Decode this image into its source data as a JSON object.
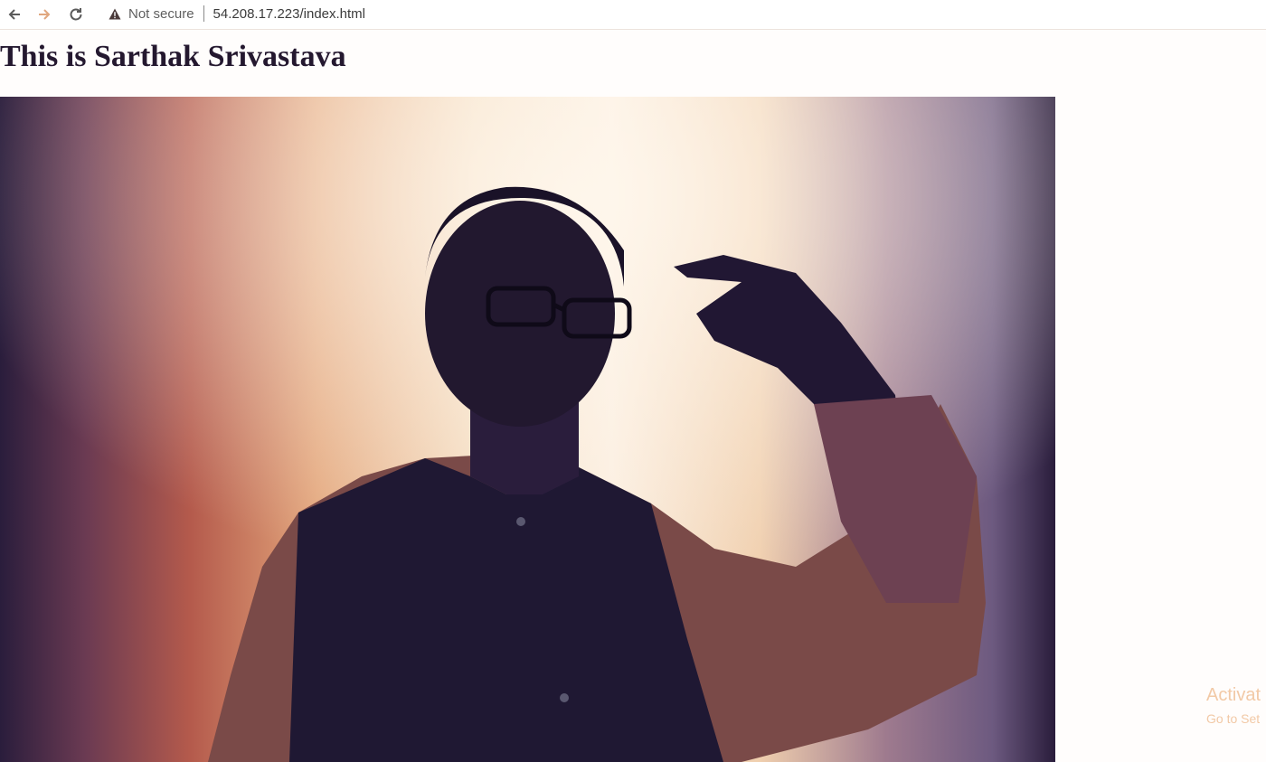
{
  "browser": {
    "security_label": "Not secure",
    "url": "54.208.17.223/index.html"
  },
  "page": {
    "heading": "This is Sarthak Srivastava"
  },
  "watermark": {
    "line1": "Activat",
    "line2": "Go to Set"
  }
}
